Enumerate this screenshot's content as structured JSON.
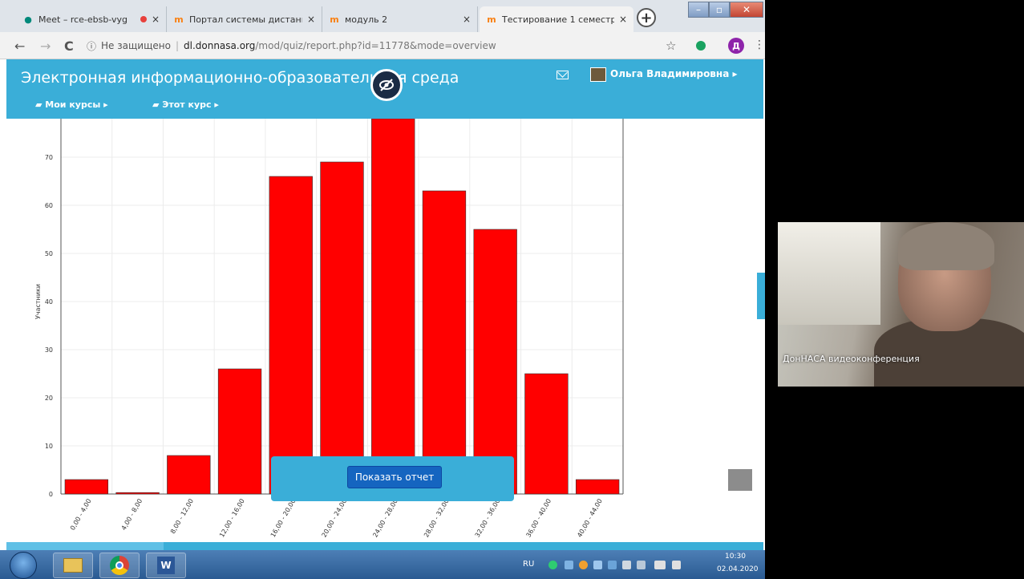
{
  "browser": {
    "tabs": [
      {
        "title": "Meet – rce-ebsb-vyg",
        "recording": true
      },
      {
        "title": "Портал системы дистанц"
      },
      {
        "title": "модуль 2"
      },
      {
        "title": "Тестирование 1 семестр",
        "active": true
      }
    ],
    "tab_close": "×",
    "new_tab": "+",
    "nav": {
      "back": "←",
      "forward": "→",
      "reload": "C"
    },
    "address": {
      "security": "Не защищено",
      "domain": "dl.donnasa.org",
      "path": "/mod/quiz/report.php?id=11778&mode=overview"
    },
    "star": "☆",
    "profile_initial": "Д",
    "menu": "⋮"
  },
  "site": {
    "title": "Электронная информационно-образовательная среда",
    "user": "Ольга Владимировна ▸",
    "nav": {
      "my_courses": "Мои курсы ▸",
      "this_course": "Этот курс ▸"
    }
  },
  "report_button": "Показать отчет",
  "chart_data": {
    "type": "bar",
    "ylabel": "Участники",
    "xlabel": "",
    "ylim": [
      0,
      78
    ],
    "yticks": [
      0,
      10,
      20,
      30,
      40,
      50,
      60,
      70
    ],
    "categories": [
      "0,00 - 4,00",
      "4,00 - 8,00",
      "8,00 - 12,00",
      "12,00 - 16,00",
      "16,00 - 20,00",
      "20,00 - 24,00",
      "24,00 - 28,00",
      "28,00 - 32,00",
      "32,00 - 36,00",
      "36,00 - 40,00",
      "40,00 - 44,00"
    ],
    "values": [
      3,
      0.3,
      8,
      26,
      66,
      69,
      78,
      63,
      55,
      25,
      3
    ],
    "bar_color": "#ff0000",
    "grid": true
  },
  "taskbar": {
    "lang": "RU",
    "time": "10:30",
    "date": "02.04.2020",
    "word_letter": "W"
  },
  "video": {
    "label": "ДонНАСА видеоконференция"
  },
  "colors": {
    "site_header": "#3aaed8",
    "button": "#1565c0"
  }
}
